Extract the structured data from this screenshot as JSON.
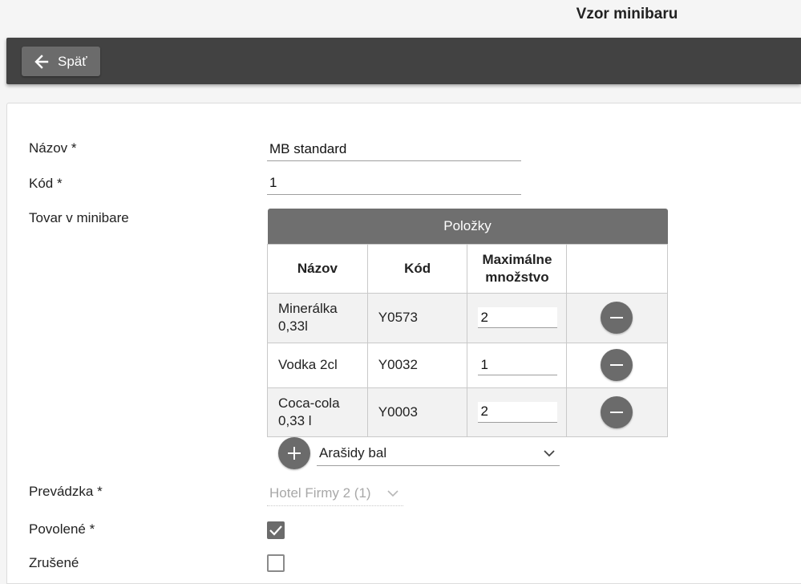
{
  "page": {
    "title": "Vzor minibaru"
  },
  "toolbar": {
    "back_label": "Späť"
  },
  "form": {
    "name_label": "Názov",
    "name_value": "MB standard",
    "code_label": "Kód",
    "code_value": "1",
    "goods_label": "Tovar v minibare",
    "operation_label": "Prevádzka",
    "operation_value": "Hotel Firmy 2 (1)",
    "enabled_label": "Povolené",
    "enabled_checked": true,
    "cancelled_label": "Zrušené",
    "cancelled_checked": false,
    "required_mark": "*"
  },
  "items_table": {
    "caption": "Položky",
    "headers": {
      "name": "Názov",
      "code": "Kód",
      "max_qty_line1": "Maximálne",
      "max_qty_line2": "množstvo"
    },
    "rows": [
      {
        "name_line1": "Minerálka",
        "name_line2": "0,33l",
        "code": "Y0573",
        "max_qty": "2"
      },
      {
        "name_line1": "Vodka 2cl",
        "name_line2": "",
        "code": "Y0032",
        "max_qty": "1"
      },
      {
        "name_line1": "Coca-cola",
        "name_line2": "0,33 l",
        "code": "Y0003",
        "max_qty": "2"
      }
    ],
    "new_item_value": "Arašidy bal"
  },
  "colors": {
    "toolbar_bg": "#424242",
    "button_bg": "#6b6b6b",
    "caption_bg": "#6f6f6f"
  },
  "icons": {
    "back": "arrow-left-icon",
    "remove": "minus-circle-icon",
    "add": "plus-circle-icon",
    "dropdown": "chevron-down-icon",
    "check": "check-icon"
  }
}
